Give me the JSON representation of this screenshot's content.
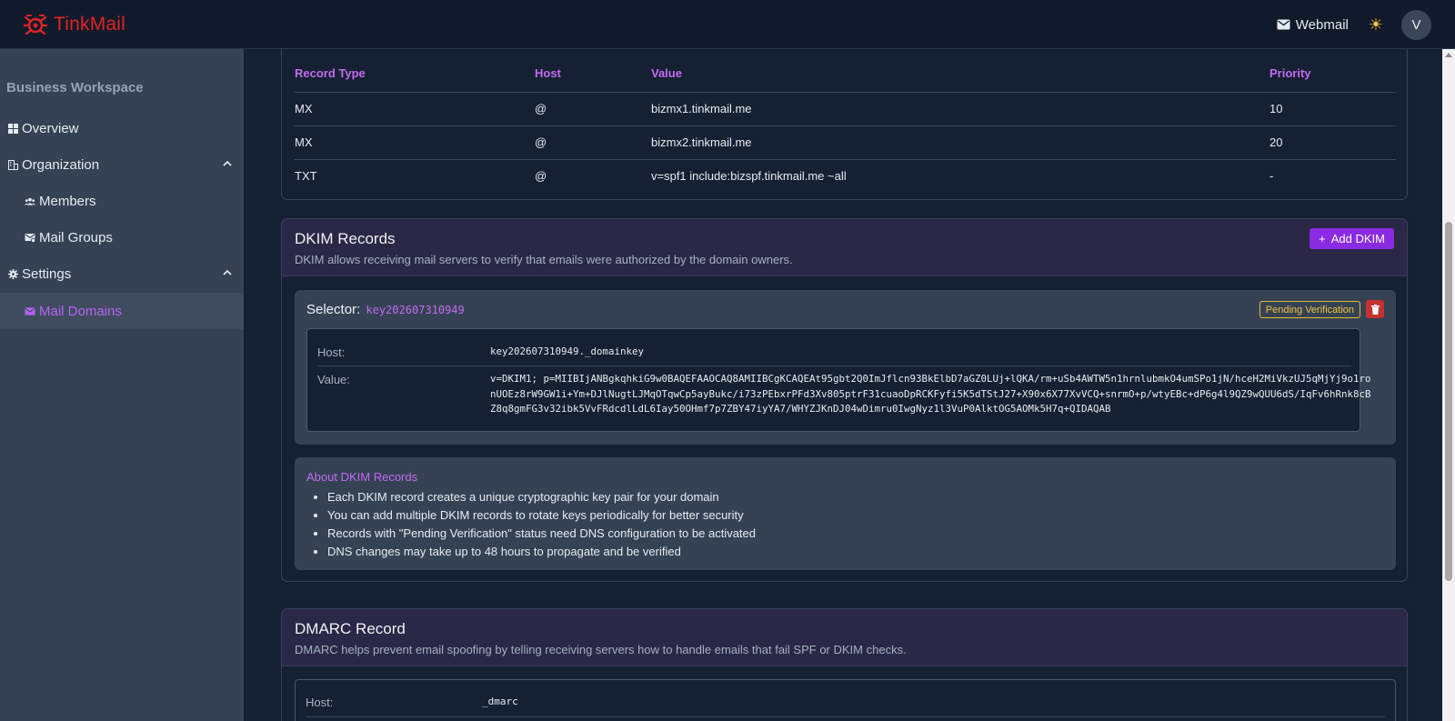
{
  "app": {
    "name": "TinkMail",
    "brand_color": "#e02424",
    "webmail_label": "Webmail",
    "avatar_initial": "V"
  },
  "sidebar": {
    "workspace_title": "Business Workspace",
    "items": [
      {
        "label": "Overview",
        "icon": "grid-icon"
      },
      {
        "label": "Organization",
        "icon": "building-icon"
      },
      {
        "label": "Members",
        "icon": "users-icon"
      },
      {
        "label": "Mail Groups",
        "icon": "mail-group-icon"
      },
      {
        "label": "Settings",
        "icon": "gear-icon"
      },
      {
        "label": "Mail Domains",
        "icon": "envelope-icon",
        "active": true
      }
    ]
  },
  "mx_table": {
    "headers": [
      "Record Type",
      "Host",
      "Value",
      "Priority"
    ],
    "rows": [
      [
        "MX",
        "@",
        "bizmx1.tinkmail.me",
        "10"
      ],
      [
        "MX",
        "@",
        "bizmx2.tinkmail.me",
        "20"
      ],
      [
        "TXT",
        "@",
        "v=spf1 include:bizspf.tinkmail.me ~all",
        "-"
      ]
    ]
  },
  "dkim": {
    "title": "DKIM Records",
    "description": "DKIM allows receiving mail servers to verify that emails were authorized by the domain owners.",
    "add_button": "Add DKIM",
    "selector_label": "Selector:",
    "selector_value": "key202607310949",
    "status": "Pending Verification",
    "host_label": "Host:",
    "host_value": "key202607310949._domainkey",
    "value_label": "Value:",
    "value_lines": [
      "v=DKIM1; p=MIIBIjANBgkqhkiG9w0BAQEFAAOCAQ8AMIIBCgKCAQEAt95gbt2Q0ImJflcn93BkElbD7aGZ0LUj+lQKA/rm+uSb4AWTW5n1hrnlubmkO4umSPo1jN/hceH2MiVkzUJ5qMjYj9o1ro",
      "nUOEz8rW9GW1i+Ym+DJlNugtLJMqOTqwCp5ayBukc/i73zPEbxrPFd3Xv805ptrF31cuaoDpRCKFyfi5K5dTStJ27+X90x6X77XvVCQ+snrmO+p/wtyEBc+dP6g4l9QZ9wQUU6dS/IqFv6hRnk8cB",
      "Z8q8gmFG3v32ibk5VvFRdcdlLdL6Iay50OHmf7p7ZBY47iyYA7/WHYZJKnDJ04wDimru0IwgNyz1l3VuP0AlktOG5AOMk5H7q+QIDAQAB"
    ],
    "about_title": "About DKIM Records",
    "about_items": [
      "Each DKIM record creates a unique cryptographic key pair for your domain",
      "You can add multiple DKIM records to rotate keys periodically for better security",
      "Records with \"Pending Verification\" status need DNS configuration to be activated",
      "DNS changes may take up to 48 hours to propagate and be verified"
    ]
  },
  "dmarc": {
    "title": "DMARC Record",
    "description": "DMARC helps prevent email spoofing by telling receiving servers how to handle emails that fail SPF or DKIM checks.",
    "host_label": "Host:",
    "host_value": "_dmarc"
  },
  "colors": {
    "accent": "#c26af0",
    "button": "#8a2be2",
    "pending": "#f1c140",
    "danger": "#c53030"
  }
}
